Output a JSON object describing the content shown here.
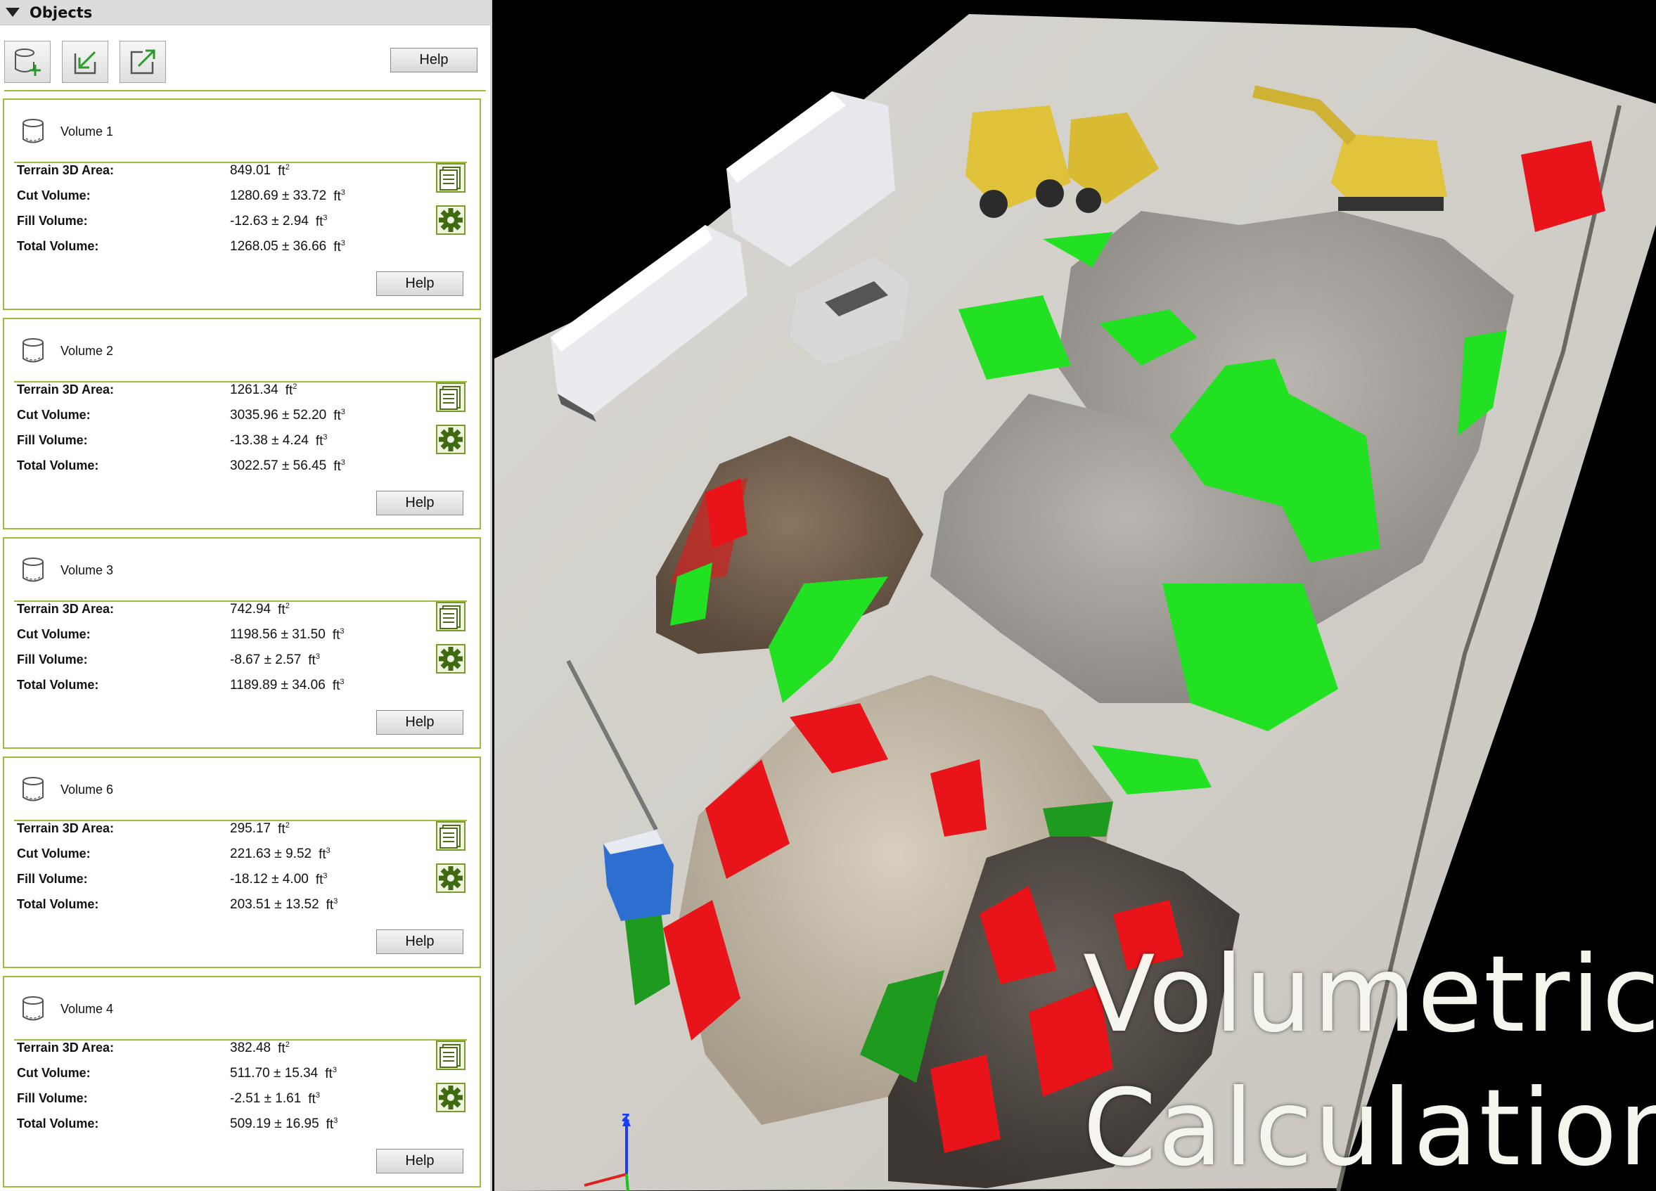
{
  "panel": {
    "title": "Objects",
    "toolbar": {
      "buttons": [
        {
          "name": "add-volume-button",
          "icon": "add-volume-icon"
        },
        {
          "name": "import-button",
          "icon": "import-icon"
        },
        {
          "name": "export-button",
          "icon": "export-icon"
        }
      ],
      "help_label": "Help"
    },
    "volumes": [
      {
        "name": "Volume 1",
        "area": "849.01",
        "area_unit": "ft",
        "cut": "1280.69  ±  33.72",
        "fill": "-12.63  ±  2.94",
        "total": "1268.05  ±  36.66",
        "vol_unit": "ft",
        "help_label": "Help"
      },
      {
        "name": "Volume 2",
        "area": "1261.34",
        "area_unit": "ft",
        "cut": "3035.96  ±  52.20",
        "fill": "-13.38  ±  4.24",
        "total": "3022.57  ±  56.45",
        "vol_unit": "ft",
        "help_label": "Help"
      },
      {
        "name": "Volume 3",
        "area": "742.94",
        "area_unit": "ft",
        "cut": "1198.56  ±  31.50",
        "fill": "-8.67  ±  2.57",
        "total": "1189.89  ±  34.06",
        "vol_unit": "ft",
        "help_label": "Help"
      },
      {
        "name": "Volume 6",
        "area": "295.17",
        "area_unit": "ft",
        "cut": "221.63  ±  9.52",
        "fill": "-18.12  ±  4.00",
        "total": "203.51  ±  13.52",
        "vol_unit": "ft",
        "help_label": "Help"
      },
      {
        "name": "Volume 4",
        "area": "382.48",
        "area_unit": "ft",
        "cut": "511.70  ±  15.34",
        "fill": "-2.51  ±  1.61",
        "total": "509.19  ±  16.95",
        "vol_unit": "ft",
        "help_label": "Help"
      }
    ],
    "labels": {
      "area": "Terrain 3D Area:",
      "cut": "Cut Volume:",
      "fill": "Fill Volume:",
      "total": "Total Volume:"
    },
    "exponents": {
      "area": "2",
      "volume": "3"
    }
  },
  "scene": {
    "overlay_line1": "Volumetric",
    "overlay_line2": "Calculations",
    "axis_label": "z",
    "colors": {
      "cut": "#e8141a",
      "fill": "#22e022",
      "accent": "#9bbb3b"
    }
  }
}
